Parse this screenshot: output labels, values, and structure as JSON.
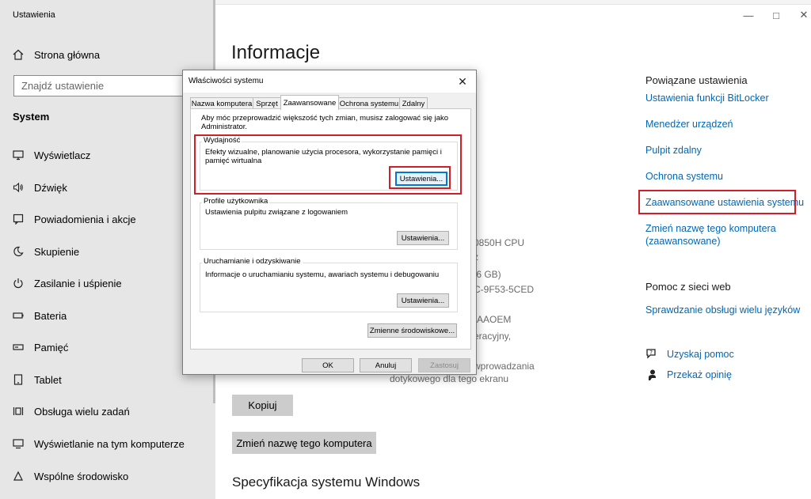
{
  "window": {
    "title": "Ustawienia"
  },
  "sidebar": {
    "home": "Strona główna",
    "search_placeholder": "Znajdź ustawienie",
    "section": "System",
    "items": [
      {
        "label": "Wyświetlacz",
        "icon": "monitor-icon"
      },
      {
        "label": "Dźwięk",
        "icon": "speaker-icon"
      },
      {
        "label": "Powiadomienia i akcje",
        "icon": "notification-icon"
      },
      {
        "label": "Skupienie",
        "icon": "moon-icon"
      },
      {
        "label": "Zasilanie i uśpienie",
        "icon": "power-icon"
      },
      {
        "label": "Bateria",
        "icon": "battery-icon"
      },
      {
        "label": "Pamięć",
        "icon": "storage-icon"
      },
      {
        "label": "Tablet",
        "icon": "tablet-icon"
      },
      {
        "label": "Obsługa wielu zadań",
        "icon": "multitask-icon"
      },
      {
        "label": "Wyświetlanie na tym komputerze",
        "icon": "project-icon"
      },
      {
        "label": "Wspólne środowisko",
        "icon": "shared-icon"
      }
    ]
  },
  "main": {
    "title": "Informacje",
    "partial_texts": [
      "0850H CPU",
      "z",
      ",6 GB)",
      "C-9F53-5CED",
      "-AAOEM",
      "eracyjny,",
      "wprowadzania",
      "dotykowego dla tego ekranu"
    ],
    "copy_button": "Kopiuj",
    "rename_button": "Zmień nazwę tego komputera",
    "specs_title": "Specyfikacja systemu Windows"
  },
  "related": {
    "title": "Powiązane ustawienia",
    "links": [
      "Ustawienia funkcji BitLocker",
      "Menedżer urządzeń",
      "Pulpit zdalny",
      "Ochrona systemu",
      "Zaawansowane ustawienia systemu",
      "Zmień nazwę tego komputera",
      "(zaawansowane)"
    ],
    "help_title": "Pomoc z sieci web",
    "help_link": "Sprawdzanie obsługi wielu języków",
    "get_help": "Uzyskaj pomoc",
    "feedback": "Przekaż opinię"
  },
  "dialog": {
    "title": "Właściwości systemu",
    "tabs": [
      "Nazwa komputera",
      "Sprzęt",
      "Zaawansowane",
      "Ochrona systemu",
      "Zdalny"
    ],
    "active_tab": "Zaawansowane",
    "admin_note_1": "Aby móc przeprowadzić większość tych zmian, musisz zalogować się jako",
    "admin_note_2": "Administrator.",
    "performance": {
      "label": "Wydajność",
      "desc_1": "Efekty wizualne, planowanie użycia procesora, wykorzystanie pamięci i",
      "desc_2": "pamięć wirtualna",
      "button": "Ustawienia..."
    },
    "profiles": {
      "label": "Profile użytkownika",
      "desc": "Ustawienia pulpitu związane z logowaniem",
      "button": "Ustawienia..."
    },
    "startup": {
      "label": "Uruchamianie i odzyskiwanie",
      "desc": "Informacje o uruchamianiu systemu, awariach systemu i debugowaniu",
      "button": "Ustawienia..."
    },
    "env_button": "Zmienne środowiskowe...",
    "ok": "OK",
    "cancel": "Anuluj",
    "apply": "Zastosuj"
  },
  "colors": {
    "link": "#0067b8",
    "highlight": "#d01e2a",
    "sidebar": "#e6e6e6"
  }
}
